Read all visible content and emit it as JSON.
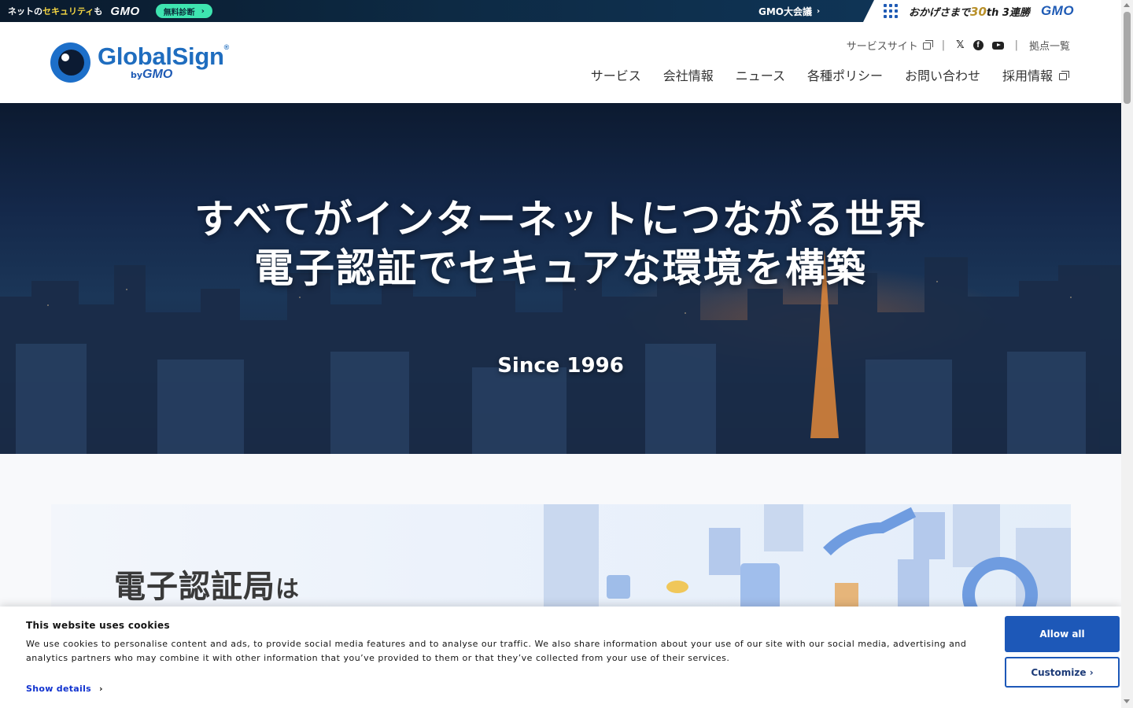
{
  "gmo_bar": {
    "tagline_prefix": "ネットの",
    "tagline_highlight": "セキュリティ",
    "tagline_suffix": "も",
    "logo": "GMO",
    "diagnosis_button": "無料診断",
    "conference_link": "GMO大会議",
    "thanks_prefix": "おかげさまで",
    "thanks_number": "30",
    "thanks_suffix": "th 3連勝",
    "logo_right": "GMO"
  },
  "header": {
    "logo_main": "GlobalSign",
    "logo_reg": "®",
    "logo_by": "by",
    "logo_by_brand": "GMO",
    "utility_nav": {
      "service_site": "サービスサイト",
      "locations": "拠点一覧"
    },
    "main_nav": [
      {
        "label": "サービス"
      },
      {
        "label": "会社情報"
      },
      {
        "label": "ニュース"
      },
      {
        "label": "各種ポリシー"
      },
      {
        "label": "お問い合わせ"
      },
      {
        "label": "採用情報"
      }
    ]
  },
  "hero": {
    "line1": "すべてがインターネットにつながる世界",
    "line2": "電子認証でセキュアな環境を構築",
    "since": "Since 1996"
  },
  "banner": {
    "title_main": "電子認証局",
    "title_particle": "は"
  },
  "cookie": {
    "title": "This website uses cookies",
    "text": "We use cookies to personalise content and ads, to provide social media features and to analyse our traffic. We also share information about your use of our site with our social media, advertising and analytics partners who may combine it with other information that you’ve provided to them or that they’ve collected from your use of their services.",
    "show_details": "Show details",
    "allow_all": "Allow all",
    "customize": "Customize"
  },
  "colors": {
    "brand_blue": "#1f6dbf",
    "cookie_button": "#1d58b8",
    "diagnosis_green": "#3ee4b0"
  }
}
